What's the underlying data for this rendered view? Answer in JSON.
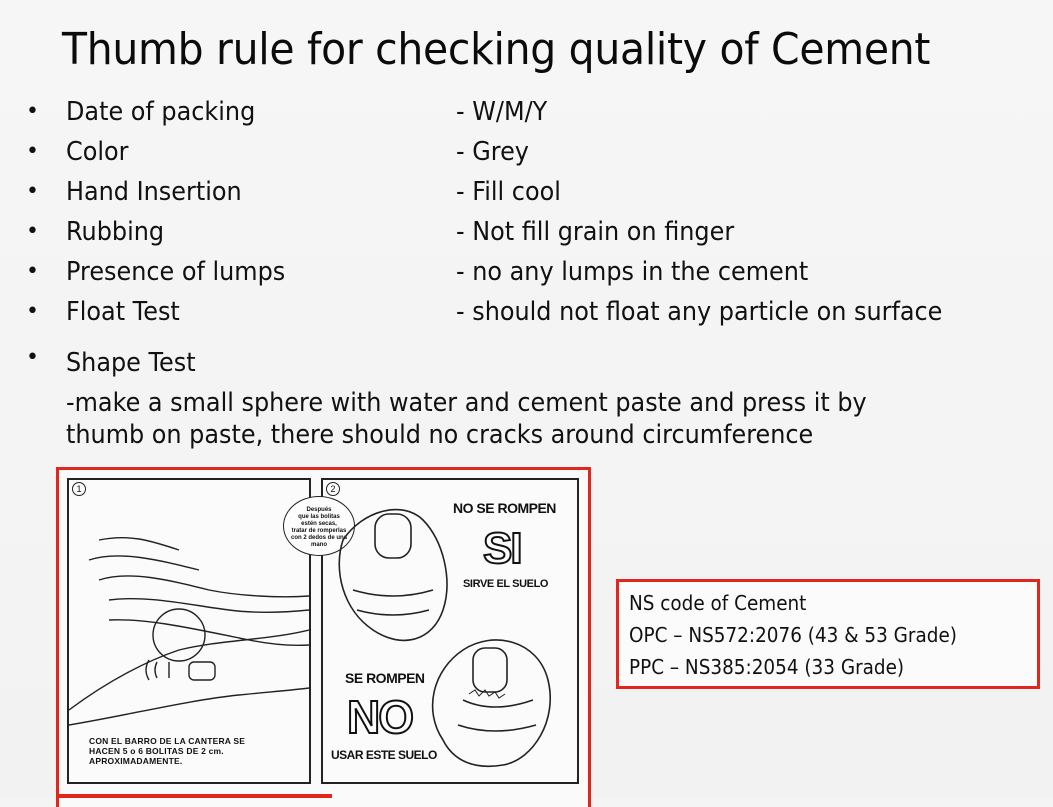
{
  "slide": {
    "title": "Thumb rule for checking quality of Cement",
    "bullets": [
      {
        "label": "Date of packing",
        "value": "- W/M/Y"
      },
      {
        "label": "Color",
        "value": "- Grey"
      },
      {
        "label": "Hand Insertion",
        "value": "- Fill cool"
      },
      {
        "label": "Rubbing",
        "value": "- Not fill grain on finger"
      },
      {
        "label": "Presence of lumps",
        "value": "- no any lumps in the cement"
      },
      {
        "label": "Float Test",
        "value": "- should not float any particle on surface"
      }
    ],
    "bullet_glyph": "•",
    "shape_test": {
      "label": "Shape Test",
      "description_lines": [
        "-make a small sphere with water and cement paste and press it by",
        "thumb on paste, there should no cracks around circumference"
      ]
    },
    "illustration": {
      "panel1": {
        "number": "1",
        "caption_lines": [
          "CON EL BARRO DE LA CANTERA SE",
          "HACEN 5 o 6 BOLITAS DE 2 cm.",
          "APROXIMADAMENTE."
        ]
      },
      "panel2": {
        "number": "2",
        "bubble_lines": [
          "Después",
          "que las bolitas",
          "estén secas,",
          "tratar de romperlas",
          "con 2 dedos de una",
          "mano"
        ],
        "top_heading": "NO SE ROMPEN",
        "top_big": "SI",
        "top_sub": "SIRVE EL SUELO",
        "bottom_heading": "SE ROMPEN",
        "bottom_big": "NO",
        "bottom_sub": "USAR ESTE SUELO"
      }
    },
    "ns_code": {
      "heading": "NS code of Cement",
      "lines": [
        "OPC – NS572:2076 (43 & 53 Grade)",
        "PPC – NS385:2054 (33 Grade)"
      ]
    },
    "colors": {
      "frame_red": "#e3261d",
      "text": "#111111",
      "background": "#f4f4f4"
    }
  }
}
